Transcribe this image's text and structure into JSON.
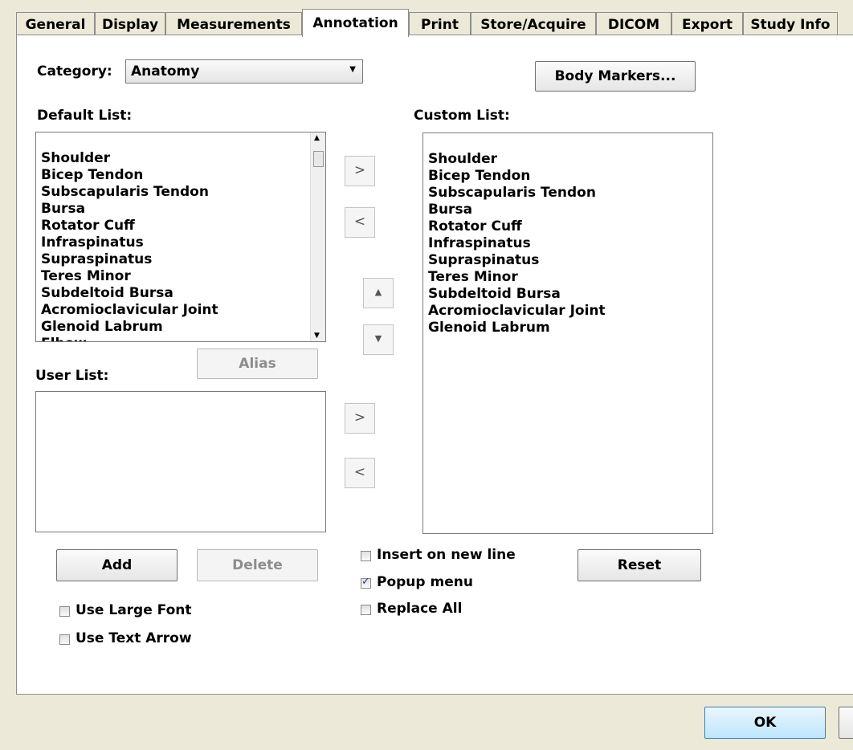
{
  "tabs": [
    "General",
    "Display",
    "Measurements",
    "Annotation",
    "Print",
    "Store/Acquire",
    "DICOM",
    "Export",
    "Study Info"
  ],
  "active_tab": "Annotation",
  "category": {
    "label": "Category:",
    "value": "Anatomy"
  },
  "body_markers_label": "Body Markers...",
  "default_list": {
    "label": "Default List:",
    "items": [
      "Shoulder",
      "Bicep Tendon",
      "Subscapularis Tendon",
      "Bursa",
      "Rotator Cuff",
      "Infraspinatus",
      "Supraspinatus",
      "Teres Minor",
      "Subdeltoid Bursa",
      "Acromioclavicular Joint",
      "Glenoid Labrum",
      "Elbow"
    ]
  },
  "custom_list": {
    "label": "Custom List:",
    "items": [
      "Shoulder",
      "Bicep Tendon",
      "Subscapularis Tendon",
      "Bursa",
      "Rotator Cuff",
      "Infraspinatus",
      "Supraspinatus",
      "Teres Minor",
      "Subdeltoid Bursa",
      "Acromioclavicular Joint",
      "Glenoid Labrum"
    ]
  },
  "user_list": {
    "label": "User List:",
    "items": []
  },
  "buttons": {
    "alias": "Alias",
    "add": "Add",
    "delete": "Delete",
    "reset": "Reset",
    "ok": "OK",
    "move_right": ">",
    "move_left": "<",
    "move_up": "▲",
    "move_down": "▼"
  },
  "checkboxes": {
    "insert_new_line": {
      "label": "Insert on new line",
      "checked": false
    },
    "popup_menu": {
      "label": "Popup menu",
      "checked": true
    },
    "replace_all": {
      "label": "Replace All",
      "checked": false
    },
    "use_large_font": {
      "label": "Use Large Font",
      "checked": false
    },
    "use_text_arrow": {
      "label": "Use Text Arrow",
      "checked": false
    }
  }
}
